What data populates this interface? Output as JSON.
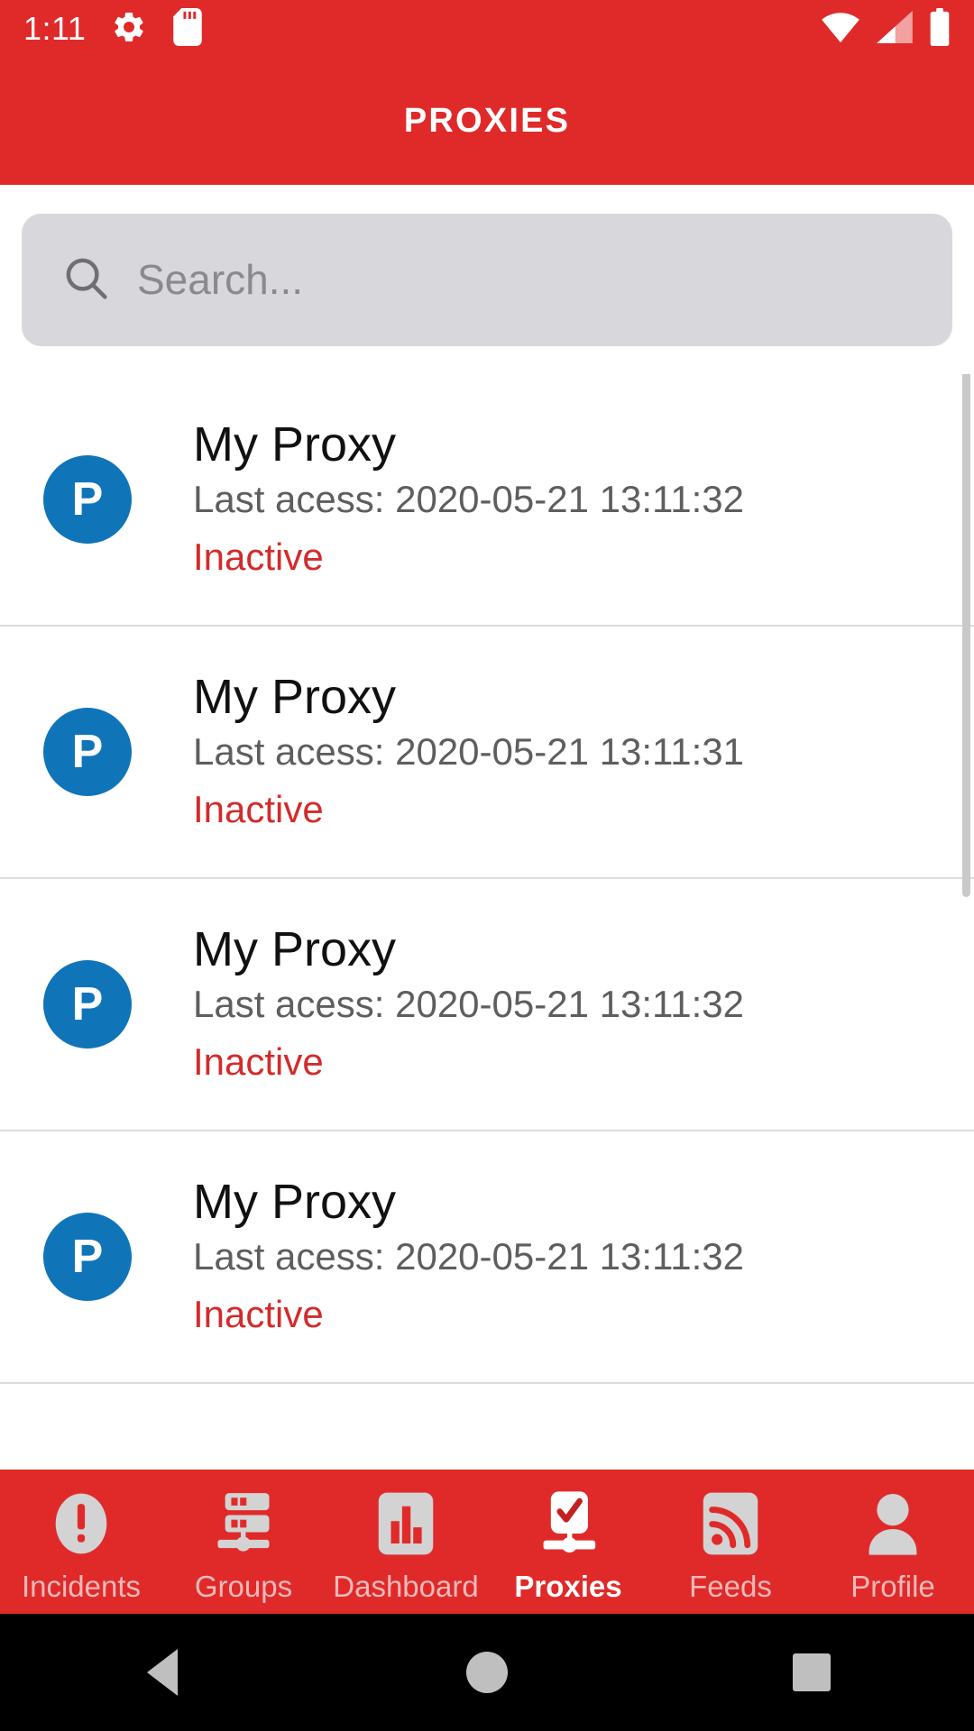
{
  "status_bar": {
    "clock": "1:11",
    "icons": [
      "gear-icon",
      "sd-card-icon",
      "wifi-icon",
      "cellular-signal-icon",
      "battery-icon"
    ]
  },
  "app_bar": {
    "title": "PROXIES"
  },
  "search": {
    "placeholder": "Search...",
    "value": "",
    "icon": "search-icon"
  },
  "proxy_list": {
    "items": [
      {
        "avatar_letter": "P",
        "title": "My Proxy",
        "subtitle": "Last acess: 2020-05-21 13:11:32",
        "status": "Inactive"
      },
      {
        "avatar_letter": "P",
        "title": "My Proxy",
        "subtitle": "Last acess: 2020-05-21 13:11:31",
        "status": "Inactive"
      },
      {
        "avatar_letter": "P",
        "title": "My Proxy",
        "subtitle": "Last acess: 2020-05-21 13:11:32",
        "status": "Inactive"
      },
      {
        "avatar_letter": "P",
        "title": "My Proxy",
        "subtitle": "Last acess: 2020-05-21 13:11:32",
        "status": "Inactive"
      }
    ]
  },
  "bottom_nav": {
    "items": [
      {
        "label": "Incidents",
        "icon": "alert-exclamation-icon",
        "active": false
      },
      {
        "label": "Groups",
        "icon": "server-rack-icon",
        "active": false
      },
      {
        "label": "Dashboard",
        "icon": "bar-chart-icon",
        "active": false
      },
      {
        "label": "Proxies",
        "icon": "proxy-check-icon",
        "active": true
      },
      {
        "label": "Feeds",
        "icon": "rss-feed-icon",
        "active": false
      },
      {
        "label": "Profile",
        "icon": "person-icon",
        "active": false
      }
    ]
  },
  "android_nav": {
    "back": "back-triangle-icon",
    "home": "home-circle-icon",
    "recents": "recents-square-icon"
  },
  "colors": {
    "brand_red": "#E02A2A",
    "status_red": "#D32B2B",
    "avatar_blue": "#0F74B8",
    "search_gray": "#D8D8DC",
    "inactive_nav": "#F0B9B9"
  }
}
